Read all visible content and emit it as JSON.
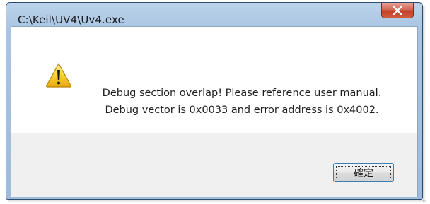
{
  "window": {
    "title": "C:\\Keil\\UV4\\Uv4.exe"
  },
  "titlebar": {
    "close_icon": "close-x-icon",
    "close_color": "#c74a33"
  },
  "message": {
    "icon": "warning-icon",
    "icon_color": "#f2c01e",
    "line1": "Debug section overlap! Please reference user manual.",
    "line2": "Debug vector is 0x0033 and error address is 0x4002."
  },
  "buttons": {
    "ok_label": "確定"
  }
}
